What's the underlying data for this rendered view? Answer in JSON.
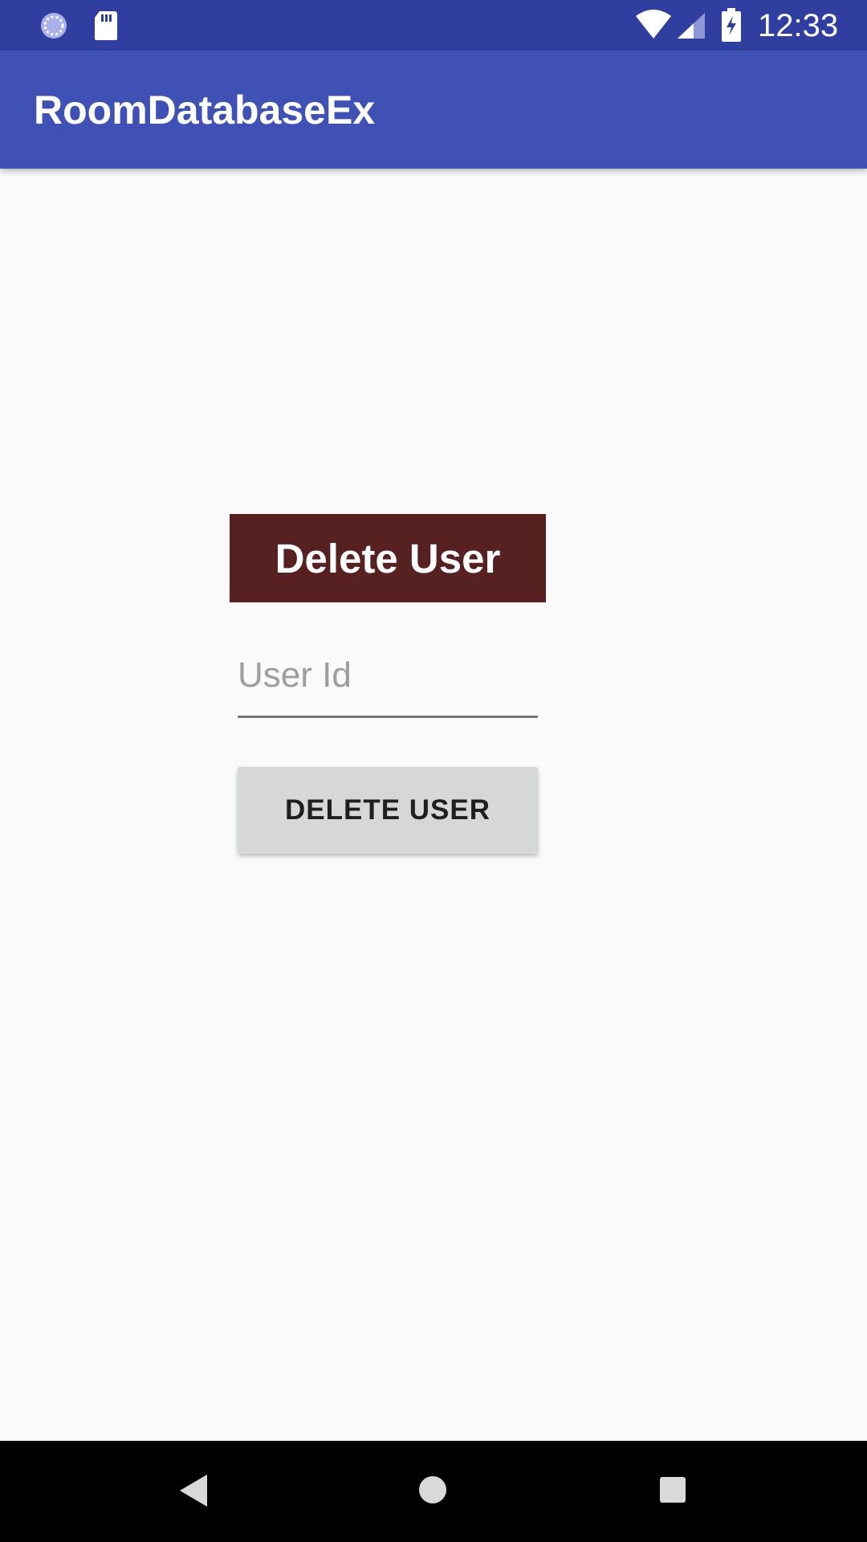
{
  "status_bar": {
    "time": "12:33",
    "icons": [
      "sync-icon",
      "sd-card-icon",
      "wifi-icon",
      "signal-icon",
      "battery-charging-icon"
    ]
  },
  "app_bar": {
    "title": "RoomDatabaseEx"
  },
  "main": {
    "heading": "Delete User",
    "user_id_input": {
      "placeholder": "User Id",
      "value": ""
    },
    "delete_button_label": "DELETE USER"
  },
  "navigation_bar": {
    "icons": [
      "back-icon",
      "home-icon",
      "recents-icon"
    ]
  },
  "colors": {
    "status_bar": "#303f9f",
    "app_bar": "#3f51b5",
    "heading_bg": "#572121",
    "button_bg": "#d6d7d7",
    "background": "#fafafa"
  }
}
